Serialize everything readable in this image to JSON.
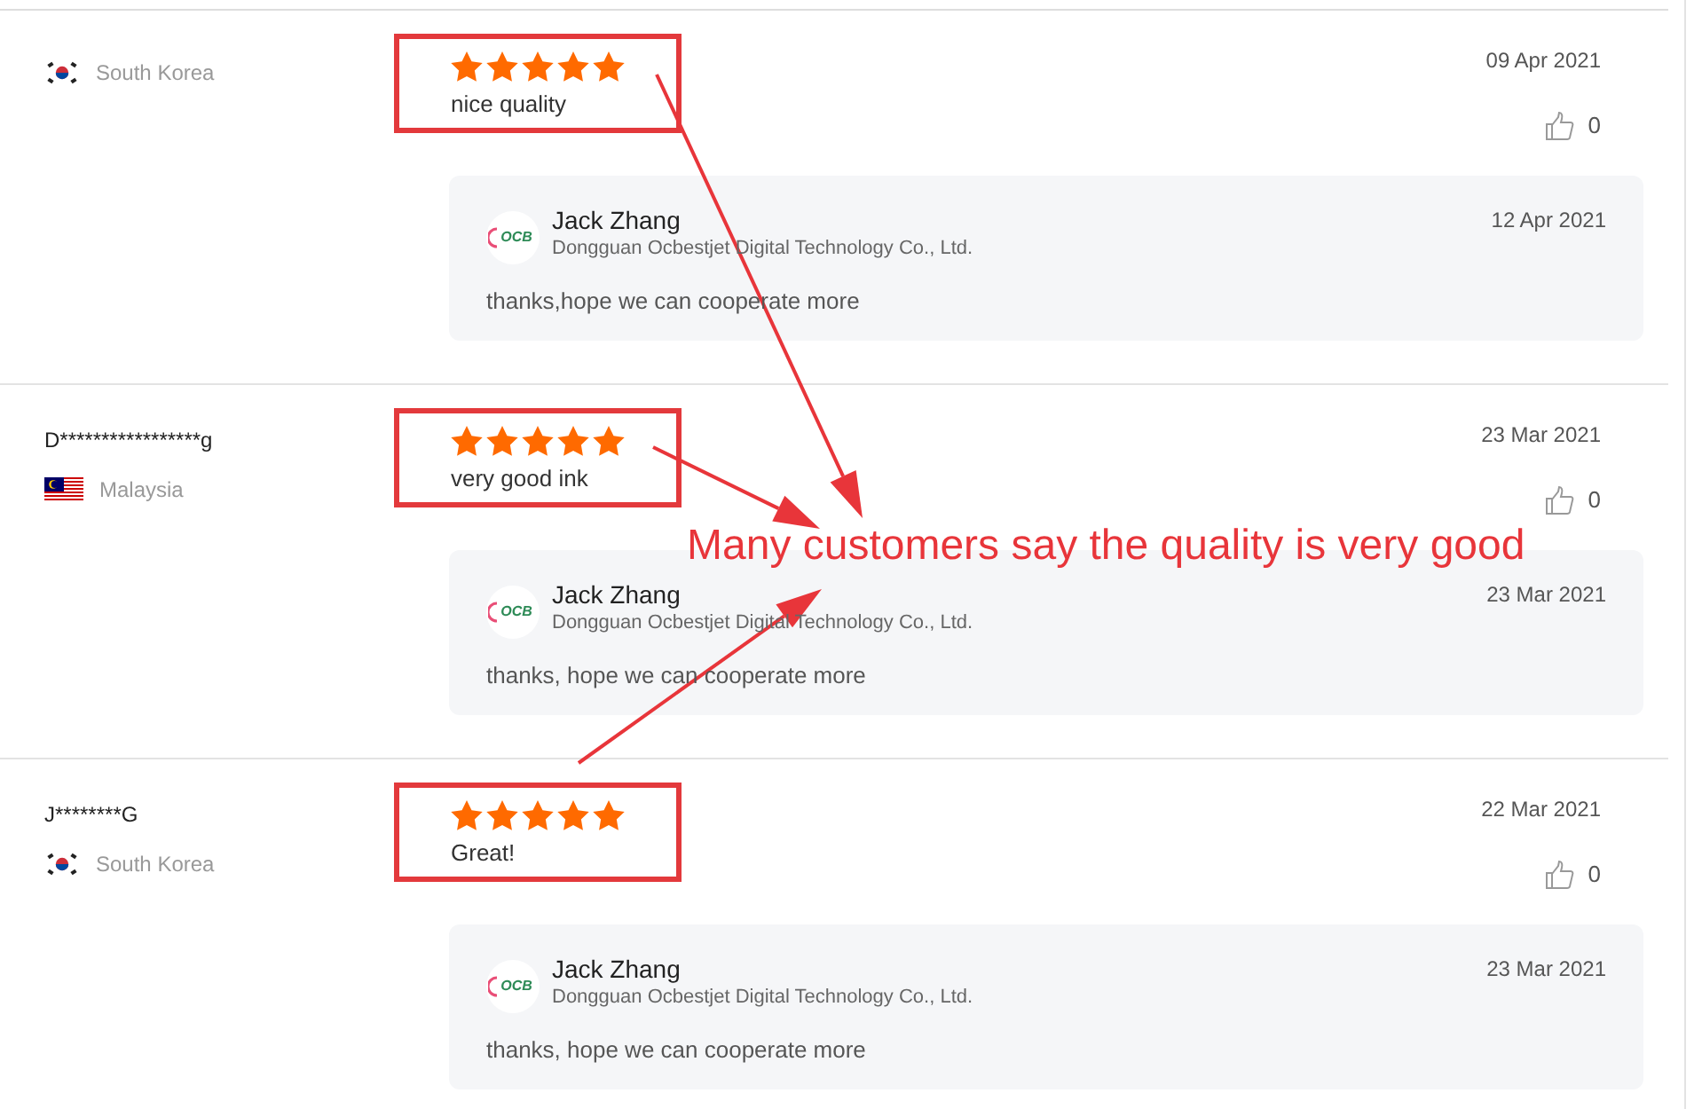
{
  "reviews": [
    {
      "country": "South Korea",
      "flag": {
        "kind": "kr"
      },
      "stars": 5,
      "comment": "nice quality",
      "date": "09 Apr 2021",
      "likes": "0",
      "highlighted": true,
      "reply": {
        "author": "Jack Zhang",
        "logo_text": "OCB",
        "company": "Dongguan Ocbestjet Digital Technology Co., Ltd.",
        "date": "12 Apr 2021",
        "text": "thanks,hope we can cooperate more"
      }
    },
    {
      "name": "D*****************g",
      "country": "Malaysia",
      "flag": {
        "kind": "my"
      },
      "stars": 5,
      "comment": "very good ink",
      "date": "23 Mar 2021",
      "likes": "0",
      "highlighted": true,
      "reply": {
        "author": "Jack Zhang",
        "logo_text": "OCB",
        "company": "Dongguan Ocbestjet Digital Technology Co., Ltd.",
        "date": "23 Mar 2021",
        "text": "thanks, hope we can cooperate more"
      }
    },
    {
      "name": "J********G",
      "country": "South Korea",
      "flag": {
        "kind": "kr"
      },
      "stars": 5,
      "comment": "Great!",
      "date": "22 Mar 2021",
      "likes": "0",
      "highlighted": true,
      "reply": {
        "author": "Jack Zhang",
        "logo_text": "OCB",
        "company": "Dongguan Ocbestjet Digital Technology Co., Ltd.",
        "date": "23 Mar 2021",
        "text": "thanks, hope we can cooperate more"
      }
    }
  ],
  "annotation": {
    "text": "Many customers say the quality is very good"
  }
}
